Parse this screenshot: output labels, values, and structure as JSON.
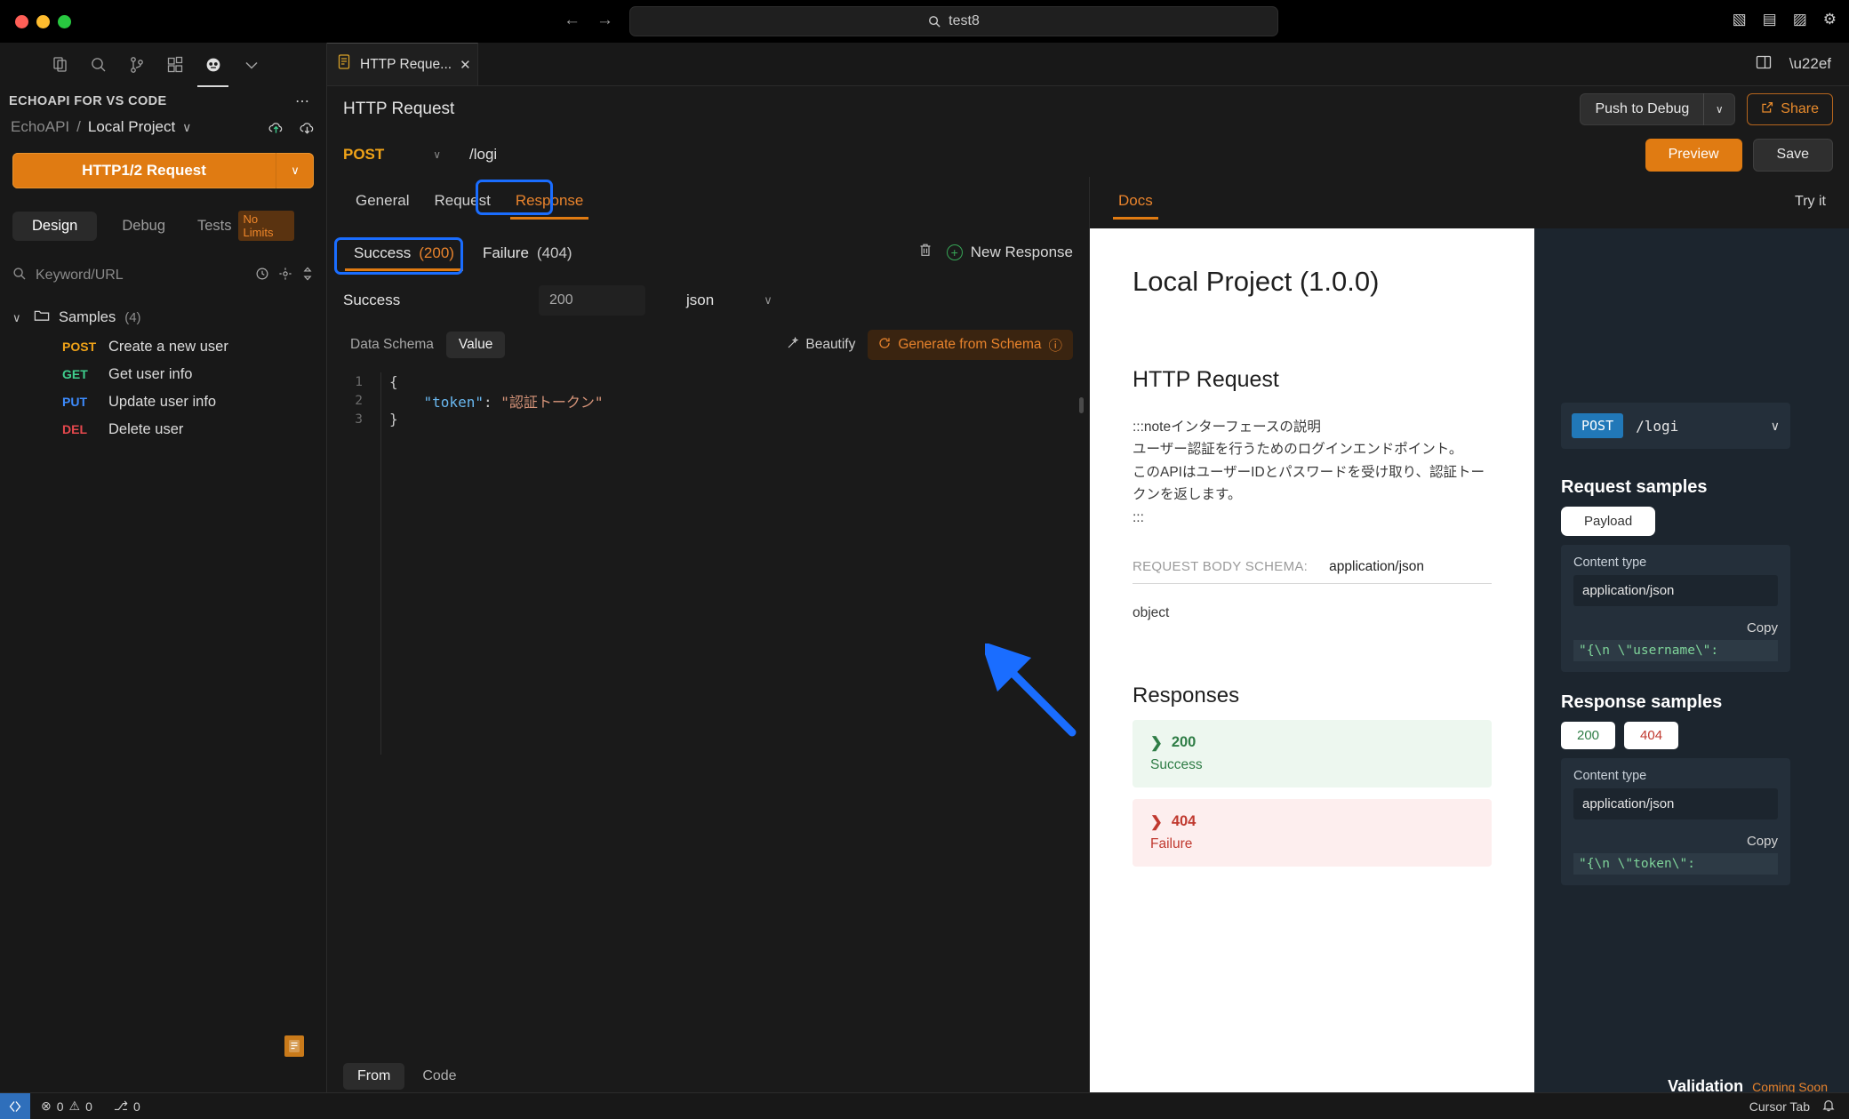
{
  "titlebar": {
    "search_value": "test8",
    "search_icon": "search-icon",
    "back_icon": "←",
    "forward_icon": "→",
    "layout_left_icon": "▧",
    "layout_bottom_icon": "▤",
    "layout_right_icon": "▨",
    "settings_icon": "⚙"
  },
  "sidebar": {
    "activity_icons": [
      "explorer-icon",
      "search-icon",
      "source-control-icon",
      "extensions-icon",
      "echoapi-icon",
      "chevron-down-icon"
    ],
    "extension_title": "ECHOAPI FOR VS CODE",
    "more_icon": "⋯",
    "breadcrumb": {
      "org": "EchoAPI",
      "separator": "/",
      "project": "Local Project",
      "chevron": "∨"
    },
    "new_request": {
      "label": "HTTP1/2 Request",
      "chevron": "∨"
    },
    "mode_tabs": [
      {
        "label": "Design",
        "active": true
      },
      {
        "label": "Debug",
        "active": false
      },
      {
        "label": "Tests",
        "active": false
      }
    ],
    "tests_badge": "No Limits",
    "search_placeholder": "Keyword/URL",
    "folder": {
      "name": "Samples",
      "count": "(4)",
      "chevron": "∨"
    },
    "requests": [
      {
        "verb": "POST",
        "name": "Create a new user"
      },
      {
        "verb": "GET",
        "name": "Get user info"
      },
      {
        "verb": "PUT",
        "name": "Update user info"
      },
      {
        "verb": "DEL",
        "name": "Delete user"
      }
    ]
  },
  "editor": {
    "tab": {
      "label": "HTTP Reque...",
      "close_icon": "✕",
      "icon": "api-doc-icon"
    },
    "tabstrip_right_icons": [
      "split-editor-icon",
      "more-actions-icon"
    ],
    "app_title": "HTTP Request",
    "push_to_debug": "Push to Debug",
    "push_chevron": "∨",
    "share": "Share",
    "share_icon": "share-icon",
    "method": "POST",
    "method_chevron": "∨",
    "url": "/logi",
    "preview": "Preview",
    "save": "Save",
    "section_tabs": [
      {
        "label": "General",
        "active": false
      },
      {
        "label": "Request",
        "active": false
      },
      {
        "label": "Response",
        "active": true
      }
    ],
    "response_tabs": [
      {
        "label": "Success",
        "code": "(200)",
        "active": true
      },
      {
        "label": "Failure",
        "code": "(404)",
        "active": false
      }
    ],
    "trash_icon": "trash-icon",
    "new_response": "New Response",
    "plus_icon": "+",
    "meta": {
      "name": "Success",
      "code": "200",
      "type": "json",
      "type_chevron": "∨"
    },
    "toolbar": {
      "data_schema": "Data Schema",
      "value": "Value",
      "beautify": "Beautify",
      "beautify_icon": "wand-icon",
      "generate": "Generate from Schema",
      "generate_icon": "refresh-icon",
      "generate_help": "ⓘ"
    },
    "code_lines": [
      {
        "num": "1",
        "parts": [
          {
            "t": "{",
            "c": "punc"
          }
        ]
      },
      {
        "num": "2",
        "parts": [
          {
            "t": "    ",
            "c": "punc"
          },
          {
            "t": "\"token\"",
            "c": "key"
          },
          {
            "t": ": ",
            "c": "punc"
          },
          {
            "t": "\"認証トークン\"",
            "c": "str"
          }
        ]
      },
      {
        "num": "3",
        "parts": [
          {
            "t": "}",
            "c": "punc"
          }
        ]
      }
    ],
    "bottom_tabs": [
      {
        "label": "From",
        "active": true
      },
      {
        "label": "Code",
        "active": false
      }
    ]
  },
  "docs": {
    "tab": "Docs",
    "try_it": "Try it",
    "title": "Local Project (1.0.0)",
    "section_title": "HTTP Request",
    "description": ":::noteインターフェースの説明\nユーザー認証を行うためのログインエンドポイント。\nこのAPIはユーザーIDとパスワードを受け取り、認証トークンを返します。\n:::",
    "schema_label": "REQUEST BODY SCHEMA:",
    "schema_value": "application/json",
    "object_label": "object",
    "responses_title": "Responses",
    "responses": [
      {
        "code": "200",
        "desc": "Success",
        "kind": "ok",
        "chevron": "❯"
      },
      {
        "code": "404",
        "desc": "Failure",
        "kind": "err",
        "chevron": "❯"
      }
    ],
    "samples": {
      "method": "POST",
      "path": "/logi",
      "chevron": "∨",
      "request_title": "Request samples",
      "payload_tab": "Payload",
      "content_type_label": "Content type",
      "content_type_value": "application/json",
      "copy": "Copy",
      "request_snippet": "\"{\\n    \\\"username\\\":",
      "response_title": "Response samples",
      "status_tabs": [
        {
          "label": "200",
          "kind": "ok"
        },
        {
          "label": "404",
          "kind": "err"
        }
      ],
      "response_content_type_label": "Content type",
      "response_content_type_value": "application/json",
      "response_copy": "Copy",
      "response_snippet": "\"{\\n    \\\"token\\\":"
    },
    "validation": "Validation",
    "validation_badge": "Coming Soon"
  },
  "statusbar": {
    "remote_icon": "⌥",
    "errors_icon": "⊗",
    "errors": "0",
    "warnings_icon": "⚠",
    "warnings": "0",
    "ports_icon": "⎇",
    "ports": "0",
    "cursor_tab": "Cursor Tab",
    "bell_icon": "🔔"
  },
  "colors": {
    "accent_orange": "#e07b12",
    "annotation_blue": "#1a6dff",
    "post_yellow": "#f0a318",
    "get_green": "#3fcf8e",
    "put_blue": "#3d8bfd",
    "del_red": "#e5484d"
  }
}
